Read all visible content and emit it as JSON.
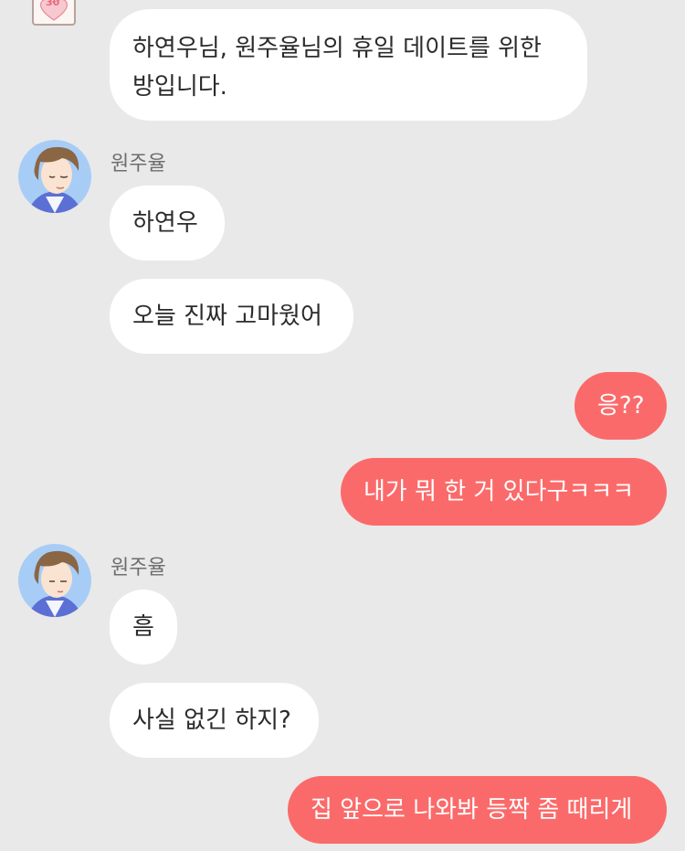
{
  "messages": [
    {
      "type": "system",
      "text": "하연우님, 원주율님의 휴일 데이트를 위한 방입니다.",
      "text_line1": "하연우님, 원주율님의 휴일 데이트를 위한",
      "text_line2": "방입니다."
    },
    {
      "type": "friend",
      "sender": "원주율",
      "text": "하연우"
    },
    {
      "type": "friend",
      "text": "오늘 진짜 고마웠어"
    },
    {
      "type": "me",
      "text": "응??"
    },
    {
      "type": "me",
      "text": "내가 뭐 한 거 있다구ㅋㅋㅋ"
    },
    {
      "type": "friend",
      "sender": "원주율",
      "text": "흠"
    },
    {
      "type": "friend",
      "text": "사실 없긴 하지?"
    },
    {
      "type": "me",
      "text": "집 앞으로 나와봐 등짝 좀 때리게"
    }
  ],
  "top_icon": {
    "label": "30",
    "icon": "heart-badge-icon"
  },
  "colors": {
    "background": "#e9e9e9",
    "friend_bubble": "#ffffff",
    "my_bubble": "#fb6a6a",
    "text": "#2b2b2b"
  }
}
